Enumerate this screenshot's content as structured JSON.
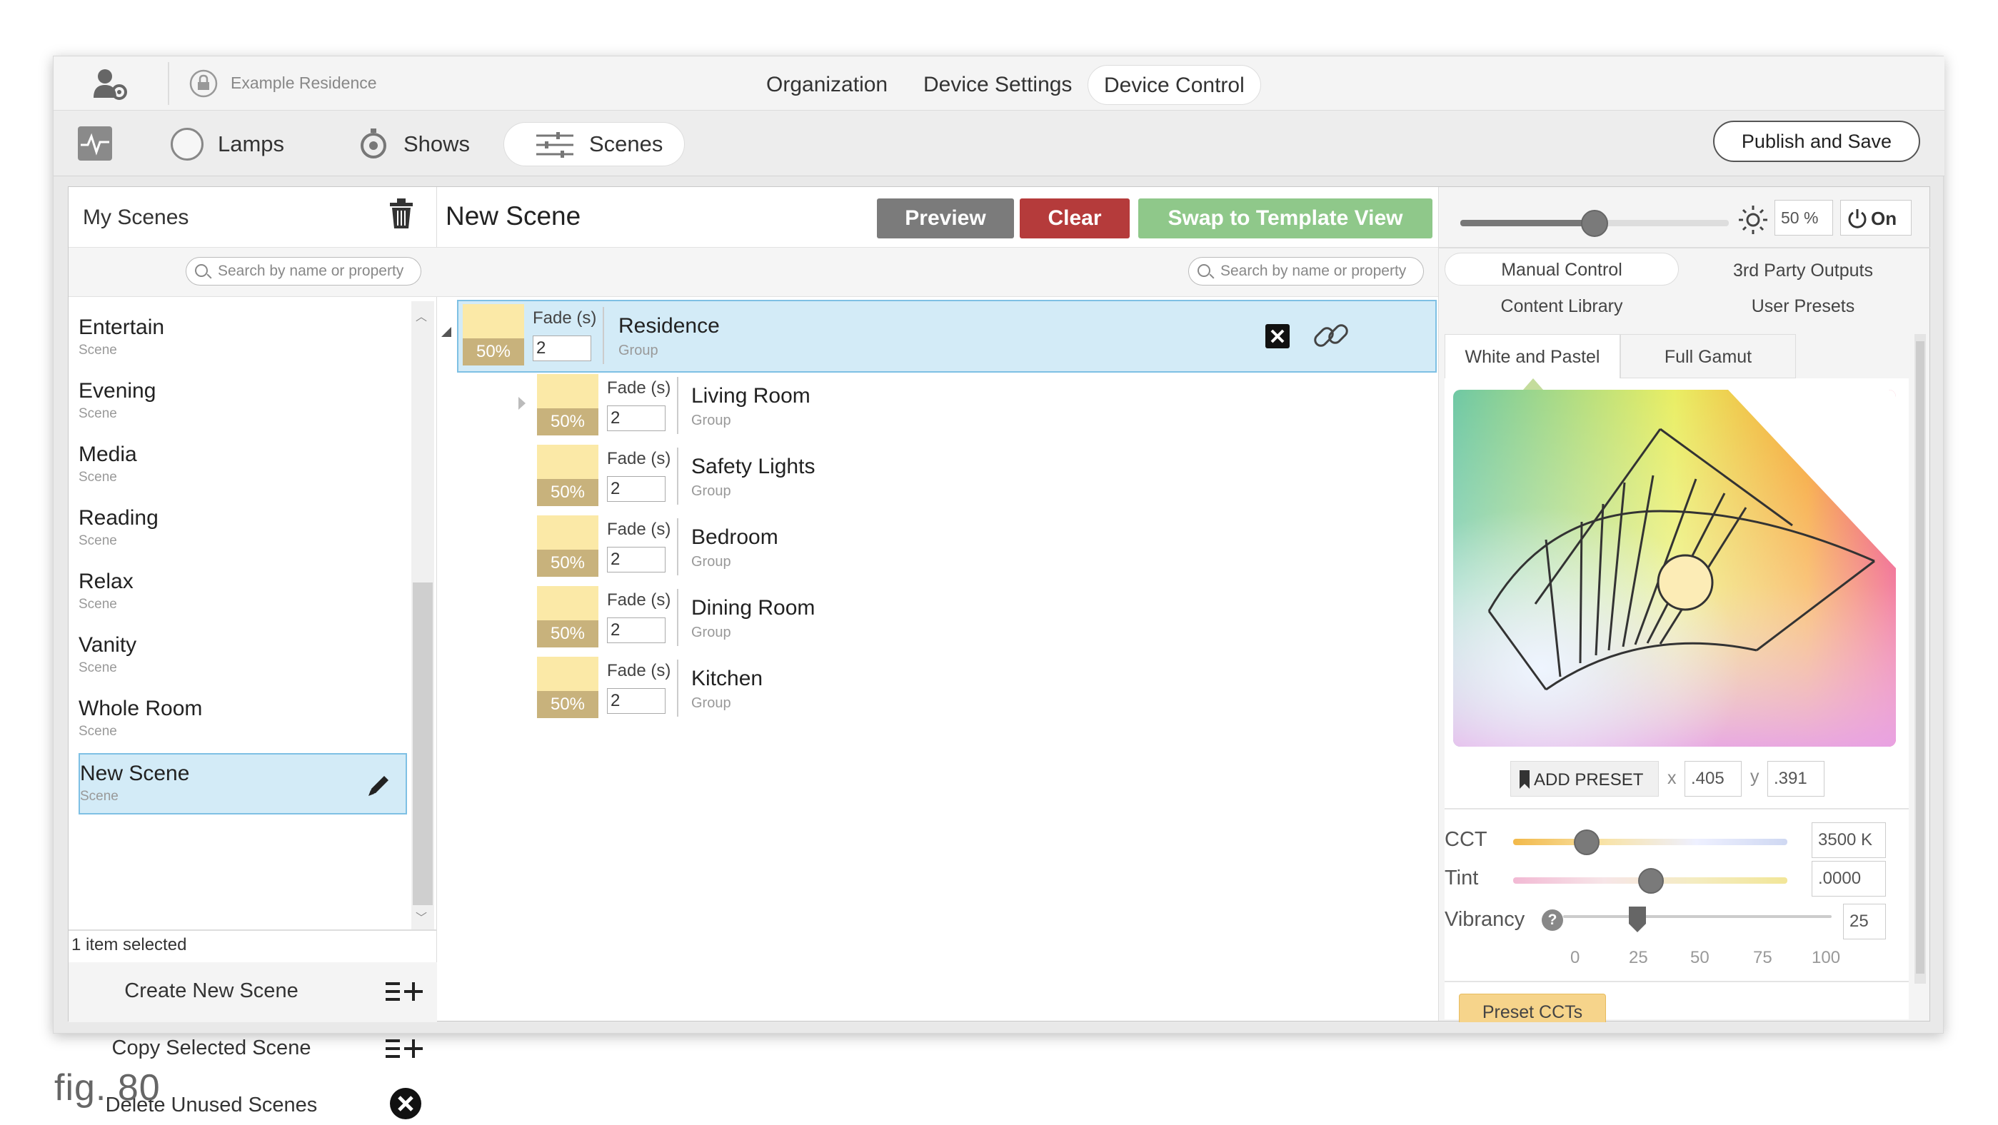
{
  "topbar": {
    "residence": "Example Residence",
    "tabs": [
      "Organization",
      "Device Settings",
      "Device Control"
    ],
    "active_tab": "Device Control"
  },
  "navbar": {
    "tabs": [
      "Lamps",
      "Shows",
      "Scenes"
    ],
    "active_tab": "Scenes",
    "publish_label": "Publish and Save"
  },
  "left": {
    "title": "My Scenes",
    "search_placeholder": "Search by name or property",
    "scenes": [
      {
        "name": "Entertain",
        "type": "Scene"
      },
      {
        "name": "Evening",
        "type": "Scene"
      },
      {
        "name": "Media",
        "type": "Scene"
      },
      {
        "name": "Reading",
        "type": "Scene"
      },
      {
        "name": "Relax",
        "type": "Scene"
      },
      {
        "name": "Vanity",
        "type": "Scene"
      },
      {
        "name": "Whole Room",
        "type": "Scene"
      },
      {
        "name": "New Scene",
        "type": "Scene"
      }
    ],
    "selected_scene": "New Scene",
    "status": "1 item selected",
    "actions": [
      "Create New Scene",
      "Copy Selected Scene",
      "Delete Unused Scenes"
    ]
  },
  "center": {
    "title": "New Scene",
    "buttons": {
      "preview": "Preview",
      "clear": "Clear",
      "swap": "Swap to Template View"
    },
    "search_placeholder": "Search by name or property",
    "fade_label": "Fade (s)",
    "root": {
      "name": "Residence",
      "type": "Group",
      "level": "50%",
      "fade": "2"
    },
    "groups": [
      {
        "name": "Living Room",
        "type": "Group",
        "level": "50%",
        "fade": "2"
      },
      {
        "name": "Safety Lights",
        "type": "Group",
        "level": "50%",
        "fade": "2"
      },
      {
        "name": "Bedroom",
        "type": "Group",
        "level": "50%",
        "fade": "2"
      },
      {
        "name": "Dining Room",
        "type": "Group",
        "level": "50%",
        "fade": "2"
      },
      {
        "name": "Kitchen",
        "type": "Group",
        "level": "50%",
        "fade": "2"
      }
    ]
  },
  "right": {
    "brightness": "50 %",
    "brightness_level": 0.5,
    "power": "On",
    "tabs": [
      "Manual Control",
      "3rd Party Outputs",
      "Content Library",
      "User Presets"
    ],
    "active_tab": "Manual Control",
    "gamut_tabs": [
      "White and Pastel",
      "Full Gamut"
    ],
    "active_gamut_tab": "White and Pastel",
    "add_preset": "ADD PRESET",
    "x_label": "x",
    "x_value": ".405",
    "y_label": "y",
    "y_value": ".391",
    "cct_label": "CCT",
    "cct_value": "3500 K",
    "tint_label": "Tint",
    "tint_value": ".0000",
    "vibrancy_label": "Vibrancy",
    "vibrancy_value": "25",
    "vibrancy_ticks": [
      "0",
      "25",
      "50",
      "75",
      "100"
    ],
    "preset_ccts": "Preset CCTs"
  },
  "caption": "fig. 80"
}
